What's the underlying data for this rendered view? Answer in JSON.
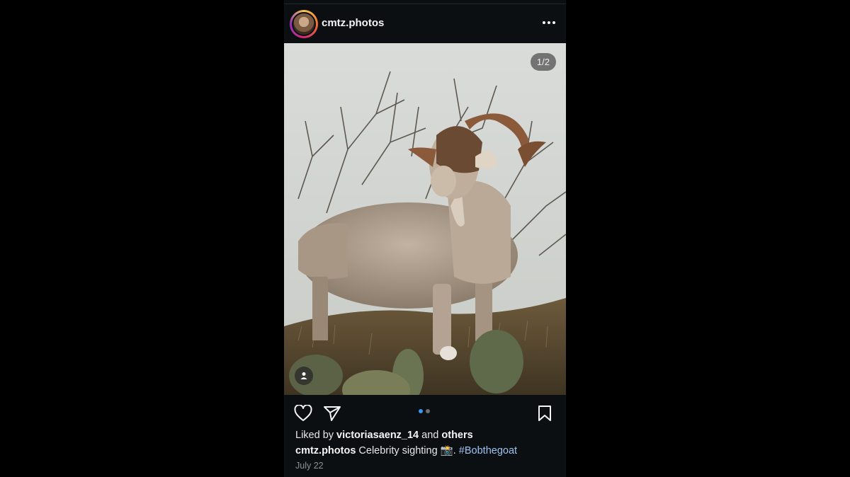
{
  "post": {
    "username": "cmtz.photos",
    "more_icon": "more-horizontal-icon",
    "media": {
      "counter": "1/2",
      "current_index": 1,
      "total": 2,
      "tag_icon": "person-icon"
    },
    "actions": {
      "like_icon": "heart-icon",
      "share_icon": "send-icon",
      "save_icon": "bookmark-icon"
    },
    "likes": {
      "prefix": "Liked by",
      "user": "victoriasaenz_14",
      "joiner": "and",
      "suffix": "others"
    },
    "caption": {
      "username": "cmtz.photos",
      "text": "Celebrity sighting 📸.",
      "hashtag": "#Bobthegoat"
    },
    "date": "July 22"
  },
  "colors": {
    "background": "#000000",
    "surface": "#0b0f12",
    "accent_dot": "#3897f0",
    "hashtag": "#9ec3f2"
  }
}
